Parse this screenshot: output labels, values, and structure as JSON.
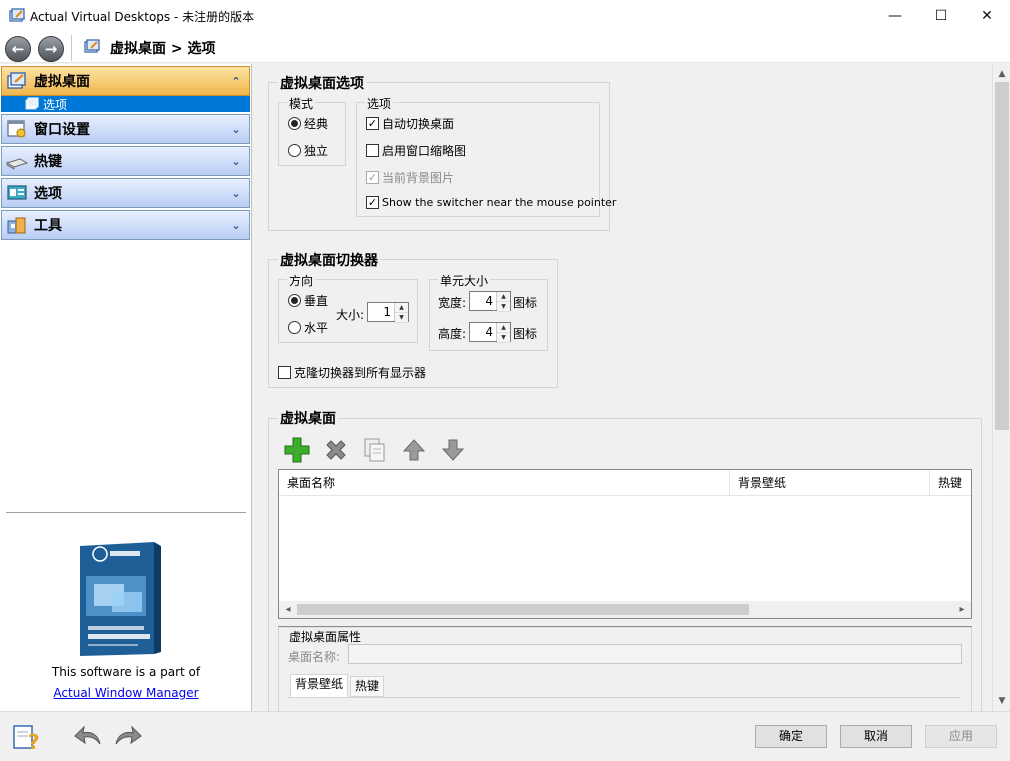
{
  "window": {
    "title": "Actual Virtual Desktops - 未注册的版本",
    "minimize": "—",
    "maximize": "☐",
    "close": "✕"
  },
  "nav": {
    "back": "←",
    "forward": "→",
    "path": "虚拟桌面 > 选项"
  },
  "sidebar": {
    "sections": [
      {
        "label": "虚拟桌面",
        "chevron": "⌃",
        "icon": "virtual-desktop-icon",
        "active": true
      },
      {
        "label": "窗口设置",
        "chevron": "⌄",
        "icon": "window-settings-icon"
      },
      {
        "label": "热键",
        "chevron": "⌄",
        "icon": "keyboard-icon"
      },
      {
        "label": "选项",
        "chevron": "⌄",
        "icon": "options-icon"
      },
      {
        "label": "工具",
        "chevron": "⌄",
        "icon": "tools-icon"
      }
    ],
    "selected_sub_item": "选项",
    "promo_text": "This software is a part of",
    "promo_link": "Actual Window Manager"
  },
  "options_group": {
    "title": "虚拟桌面选项",
    "mode": {
      "title": "模式",
      "options": [
        {
          "label": "经典",
          "selected": true
        },
        {
          "label": "独立",
          "selected": false
        }
      ]
    },
    "options": {
      "title": "选项",
      "items": [
        {
          "label": "自动切换桌面",
          "checked": true,
          "enabled": true
        },
        {
          "label": "启用窗口缩略图",
          "checked": false,
          "enabled": true
        },
        {
          "label": "当前背景图片",
          "checked": true,
          "enabled": false
        },
        {
          "label": "Show the switcher near the mouse pointer",
          "checked": true,
          "enabled": true
        }
      ]
    }
  },
  "switcher_group": {
    "title": "虚拟桌面切换器",
    "direction": {
      "title": "方向",
      "options": [
        {
          "label": "垂直",
          "selected": true
        },
        {
          "label": "水平",
          "selected": false
        }
      ],
      "size_label": "大小:",
      "size_value": "1"
    },
    "cell_size": {
      "title": "单元大小",
      "width_label": "宽度:",
      "width_value": "4",
      "height_label": "高度:",
      "height_value": "4",
      "unit": "图标"
    },
    "clone_label": "克隆切换器到所有显示器",
    "clone_checked": false
  },
  "desktops_group": {
    "title": "虚拟桌面",
    "columns": [
      "桌面名称",
      "背景壁纸",
      "热键"
    ],
    "properties": {
      "title": "虚拟桌面属性",
      "name_label": "桌面名称:",
      "name_value": "",
      "tabs": [
        "背景壁纸",
        "热键"
      ]
    }
  },
  "bottom": {
    "ok": "确定",
    "cancel": "取消",
    "apply": "应用"
  },
  "colors": {
    "accent": "#0078d7",
    "active_section": "#f0b64a",
    "section": "#b9cdf5",
    "add_green": "#3cae2c"
  }
}
